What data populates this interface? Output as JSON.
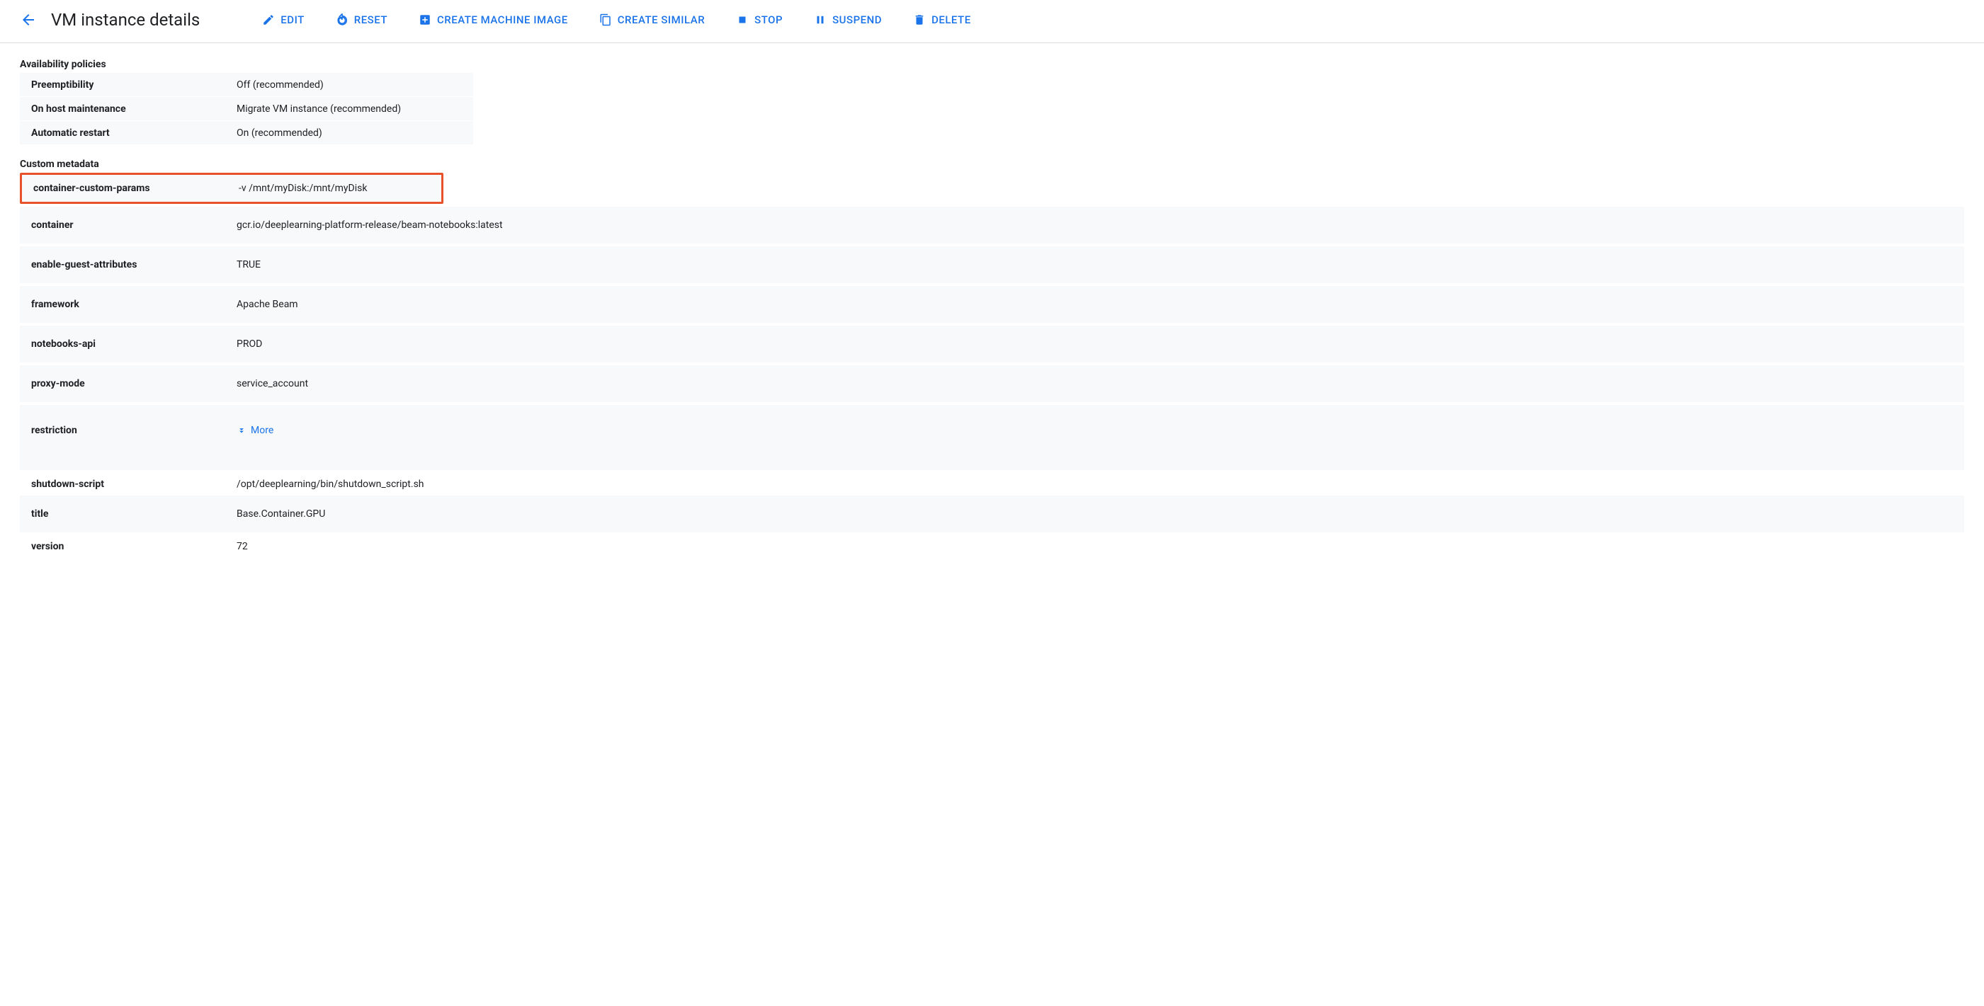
{
  "header": {
    "title": "VM instance details",
    "actions": {
      "edit": "EDIT",
      "reset": "RESET",
      "create_machine_image": "CREATE MACHINE IMAGE",
      "create_similar": "CREATE SIMILAR",
      "stop": "STOP",
      "suspend": "SUSPEND",
      "delete": "DELETE"
    }
  },
  "sections": {
    "availability_policies_title": "Availability policies",
    "custom_metadata_title": "Custom metadata"
  },
  "policies": {
    "preemptibility": {
      "key": "Preemptibility",
      "value": "Off (recommended)"
    },
    "on_host_maintenance": {
      "key": "On host maintenance",
      "value": "Migrate VM instance (recommended)"
    },
    "automatic_restart": {
      "key": "Automatic restart",
      "value": "On (recommended)"
    }
  },
  "metadata": {
    "container_custom_params": {
      "key": "container-custom-params",
      "value": "-v /mnt/myDisk:/mnt/myDisk"
    },
    "container": {
      "key": "container",
      "value": "gcr.io/deeplearning-platform-release/beam-notebooks:latest"
    },
    "enable_guest_attributes": {
      "key": "enable-guest-attributes",
      "value": "TRUE"
    },
    "framework": {
      "key": "framework",
      "value": "Apache Beam"
    },
    "notebooks_api": {
      "key": "notebooks-api",
      "value": "PROD"
    },
    "proxy_mode": {
      "key": "proxy-mode",
      "value": "service_account"
    },
    "restriction": {
      "key": "restriction",
      "more_label": "More"
    },
    "shutdown_script": {
      "key": "shutdown-script",
      "value": "/opt/deeplearning/bin/shutdown_script.sh"
    },
    "title": {
      "key": "title",
      "value": "Base.Container.GPU"
    },
    "version": {
      "key": "version",
      "value": "72"
    }
  }
}
